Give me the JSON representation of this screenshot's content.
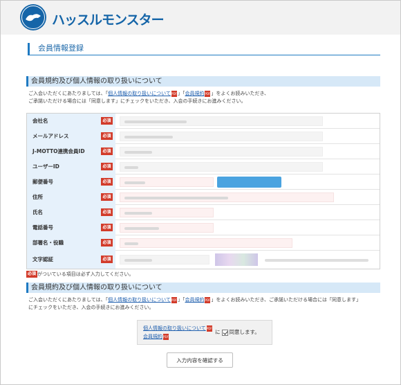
{
  "header": {
    "logo_text": "ハッスルモンスター",
    "badge_icon": "hustle-monster-badge"
  },
  "page_title": "会員情報登録",
  "section1": {
    "title": "会員規約及び個人情報の取り扱いについて",
    "line1_prefix": "ご入会いただくにあたりましては、「",
    "privacy_link": "個人情報の取り扱いについて",
    "mid": "」「",
    "terms_link": "会員規約",
    "line1_suffix": "」をよくお読みいただき、",
    "line2": "ご承諾いただける場合には「同意します」にチェックをいただき、入会の手続きにお進みください。"
  },
  "required_badge": "必須",
  "form_rows": [
    {
      "label": "会社名"
    },
    {
      "label": "メールアドレス"
    },
    {
      "label": "J-MOTTO連携会員ID"
    },
    {
      "label": "ユーザーID"
    },
    {
      "label": "郵便番号"
    },
    {
      "label": "住所"
    },
    {
      "label": "氏名"
    },
    {
      "label": "電話番号"
    },
    {
      "label": "部署名・役職"
    },
    {
      "label": "文字認証"
    }
  ],
  "required_note": "がついている項目は必ず入力してください。",
  "section2": {
    "title": "会員規約及び個人情報の取り扱いについて",
    "line1_prefix": "ご入会いただくにあたりましては、「",
    "privacy_link": "個人情報の取り扱いについて",
    "mid": "」「",
    "terms_link": "会員規約",
    "line1_suffix": "」をよくお読みいただき、ご承諾いただける場合には「同意します」",
    "line2": "にチェックをいただき、入会の手続きにお進みください。"
  },
  "consent": {
    "privacy_link": "個人情報の取り扱いについて",
    "terms_link": "会員規約",
    "ni": "に",
    "agree_label": "同意します。",
    "checked": true
  },
  "confirm_button": "入力内容を確認する",
  "colors": {
    "brand": "#1565a8",
    "required": "#d23b2a",
    "label_bg": "#e6f1fb",
    "section_bg": "#d6e8f7"
  }
}
